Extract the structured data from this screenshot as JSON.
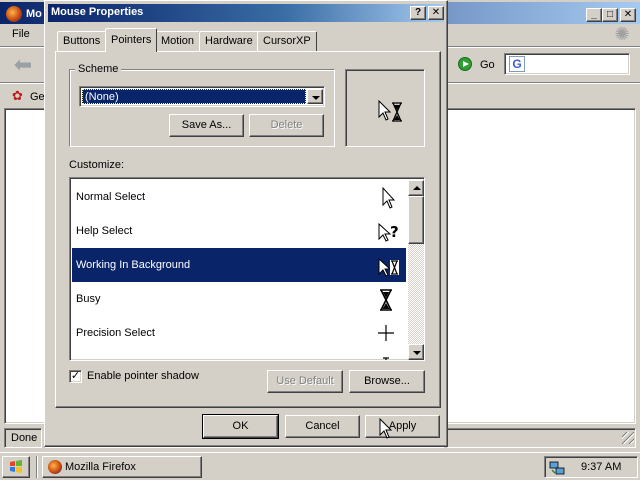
{
  "firefox": {
    "title": "Mo",
    "menu_file": "File",
    "go_label": "Go",
    "bookmark_label": "Ge",
    "status": "Done",
    "search_engine_letter": "G"
  },
  "dialog": {
    "title": "Mouse Properties",
    "help_glyph": "?",
    "close_glyph": "✕",
    "tabs": [
      {
        "label": "Buttons",
        "active": false
      },
      {
        "label": "Pointers",
        "active": true
      },
      {
        "label": "Motion",
        "active": false
      },
      {
        "label": "Hardware",
        "active": false
      },
      {
        "label": "CursorXP",
        "active": false
      }
    ],
    "scheme": {
      "legend": "Scheme",
      "selected": "(None)",
      "save_as": "Save As...",
      "delete": "Delete"
    },
    "customize_label": "Customize:",
    "pointers": [
      {
        "label": "Normal Select",
        "icon": "arrow-cursor-icon",
        "selected": false
      },
      {
        "label": "Help Select",
        "icon": "help-cursor-icon",
        "selected": false
      },
      {
        "label": "Working In Background",
        "icon": "working-cursor-icon",
        "selected": true
      },
      {
        "label": "Busy",
        "icon": "hourglass-icon",
        "selected": false
      },
      {
        "label": "Precision Select",
        "icon": "crosshair-icon",
        "selected": false
      },
      {
        "label": "",
        "icon": "text-cursor-icon",
        "selected": false
      }
    ],
    "enable_shadow": {
      "label": "Enable pointer shadow",
      "checked": true,
      "check_glyph": "✓"
    },
    "use_default": "Use Default",
    "browse": "Browse...",
    "ok": "OK",
    "cancel": "Cancel",
    "apply": "Apply"
  },
  "taskbar": {
    "task_label": "Mozilla Firefox",
    "clock": "9:37 AM"
  },
  "colors": {
    "selection": "#0a246a",
    "face": "#d4d0c8",
    "title_active": "#0a246a"
  }
}
